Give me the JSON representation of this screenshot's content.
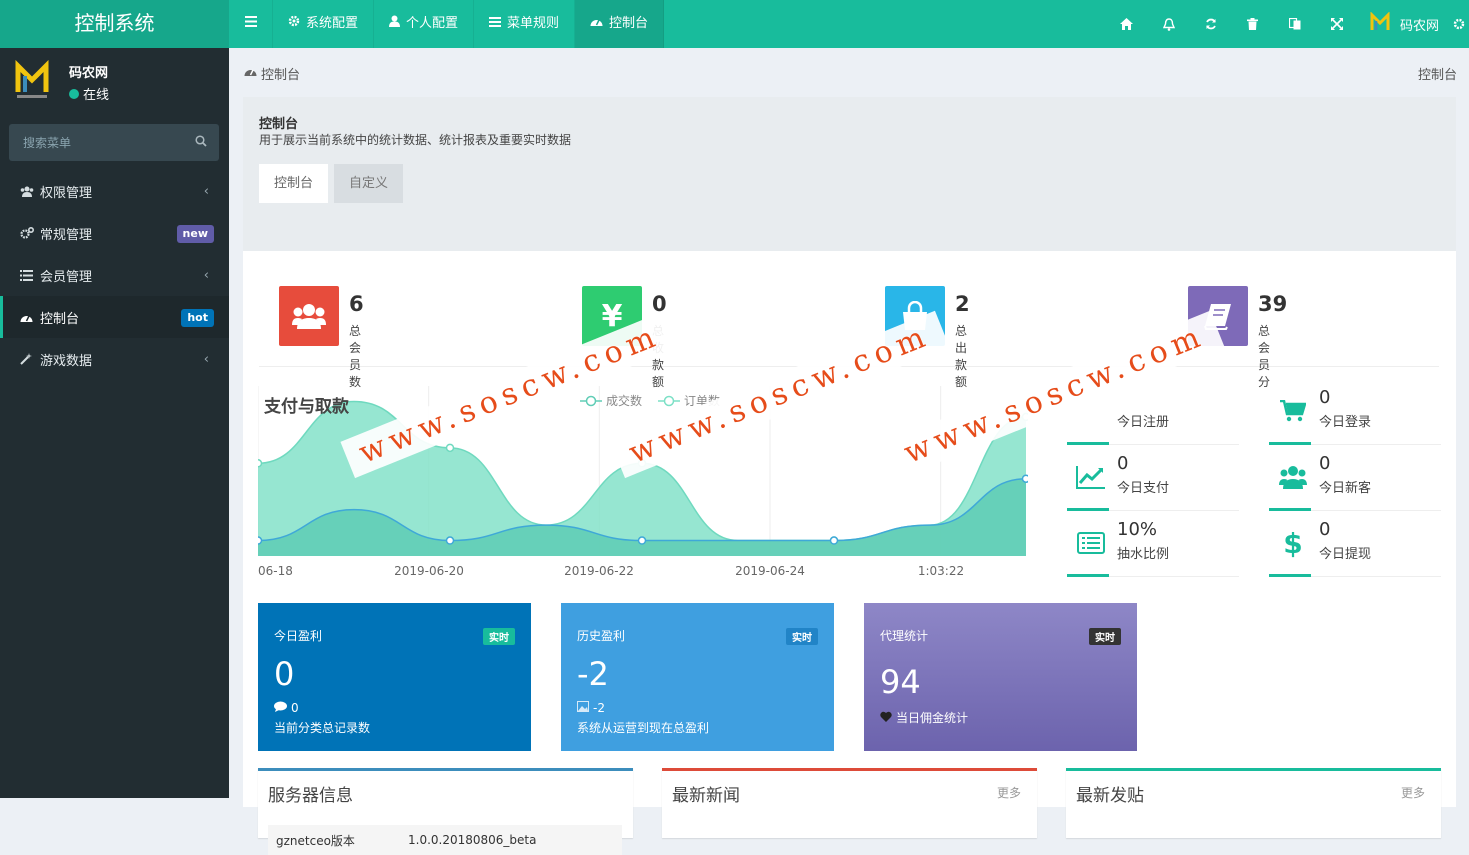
{
  "app": {
    "title": "控制系统"
  },
  "topnav": {
    "items": [
      {
        "label": "系统配置",
        "icon": "gear-icon"
      },
      {
        "label": "个人配置",
        "icon": "user-icon"
      },
      {
        "label": "菜单规则",
        "icon": "list-icon"
      },
      {
        "label": "控制台",
        "icon": "dashboard-icon"
      }
    ],
    "active": "控制台",
    "right_icons": [
      "home-icon",
      "bell-icon",
      "refresh-icon",
      "trash-icon",
      "translate-icon",
      "fullscreen-icon"
    ],
    "user": "码农网"
  },
  "sidebar": {
    "user": {
      "name": "码农网",
      "status": "在线"
    },
    "search": {
      "placeholder": "搜索菜单"
    },
    "items": [
      {
        "label": "权限管理",
        "icon": "users-icon",
        "badge": "",
        "arrow": "‹"
      },
      {
        "label": "常规管理",
        "icon": "cogs-icon",
        "badge": "new",
        "badge_color": "#605ca8",
        "arrow": ""
      },
      {
        "label": "会员管理",
        "icon": "list-icon",
        "badge": "",
        "arrow": "‹"
      },
      {
        "label": "控制台",
        "icon": "dashboard-icon",
        "badge": "hot",
        "badge_color": "#0073b7",
        "arrow": ""
      },
      {
        "label": "游戏数据",
        "icon": "magic-icon",
        "badge": "",
        "arrow": "‹"
      }
    ]
  },
  "breadcrumb": {
    "current": "控制台",
    "right": "控制台"
  },
  "panel": {
    "title": "控制台",
    "desc": "用于展示当前系统中的统计数据、统计报表及重要实时数据",
    "tabs": [
      "控制台",
      "自定义"
    ]
  },
  "stats": [
    {
      "value": "6",
      "label": "总会员数",
      "color": "#e74c3c",
      "icon": "users-icon"
    },
    {
      "value": "0",
      "label": "总收款额",
      "color": "#2ecc71",
      "icon": "yen-icon"
    },
    {
      "value": "2",
      "label": "总出款额",
      "color": "#29b6e8",
      "icon": "bag-icon"
    },
    {
      "value": "39",
      "label": "总会员分",
      "color": "#7e6ab8",
      "icon": "book-icon"
    }
  ],
  "chart_data": {
    "type": "area",
    "title": "支付与取款",
    "legend": [
      "成交数",
      "订单数"
    ],
    "x_ticks": [
      "06-18",
      "2019-06-20",
      "2019-06-22",
      "2019-06-24",
      "1:03:22"
    ],
    "series": [
      {
        "name": "订单数",
        "color": "#7ce0c6",
        "values": [
          6,
          10,
          7,
          2,
          6,
          1,
          1,
          2,
          9
        ]
      },
      {
        "name": "成交数",
        "color": "#60cdb6",
        "values": [
          1,
          3,
          1,
          2,
          1,
          1,
          1,
          2,
          5
        ]
      }
    ]
  },
  "minis": [
    {
      "value": "",
      "label": "今日注册",
      "icon": "user-plus-icon"
    },
    {
      "value": "0",
      "label": "今日登录",
      "icon": "cart-icon"
    },
    {
      "value": "0",
      "label": "今日支付",
      "icon": "chart-line-icon"
    },
    {
      "value": "0",
      "label": "今日新客",
      "icon": "users-icon"
    },
    {
      "value": "10%",
      "label": "抽水比例",
      "icon": "list-alt-icon"
    },
    {
      "value": "0",
      "label": "今日提现",
      "icon": "dollar-icon"
    }
  ],
  "cards": [
    {
      "title": "今日盈利",
      "badge": "实时",
      "value": "0",
      "sub": "0",
      "sub_icon": "comment-icon",
      "desc": "当前分类总记录数",
      "bg": "#0073b7",
      "badge_bg": "#18bc9c"
    },
    {
      "title": "历史盈利",
      "badge": "实时",
      "value": "-2",
      "sub": "-2",
      "sub_icon": "image-icon",
      "desc": "系统从运营到现在总盈利",
      "bg": "#3f9fe0",
      "badge_bg": "#2184c7"
    },
    {
      "title": "代理统计",
      "badge": "实时",
      "value": "94",
      "sub": "当日佣金统计",
      "sub_icon": "heart-icon",
      "desc": "",
      "bg": "#7d72b8",
      "badge_bg": "#333"
    }
  ],
  "panels": [
    {
      "title": "服务器信息",
      "more": "",
      "border": "#3c8dbc"
    },
    {
      "title": "最新新闻",
      "more": "更多",
      "border": "#dd4b39"
    },
    {
      "title": "最新发贴",
      "more": "更多",
      "border": "#18bc9c"
    }
  ],
  "server": {
    "key": "gznetceo版本",
    "value": "1.0.0.20180806_beta"
  },
  "watermark": "www.soscw.com"
}
